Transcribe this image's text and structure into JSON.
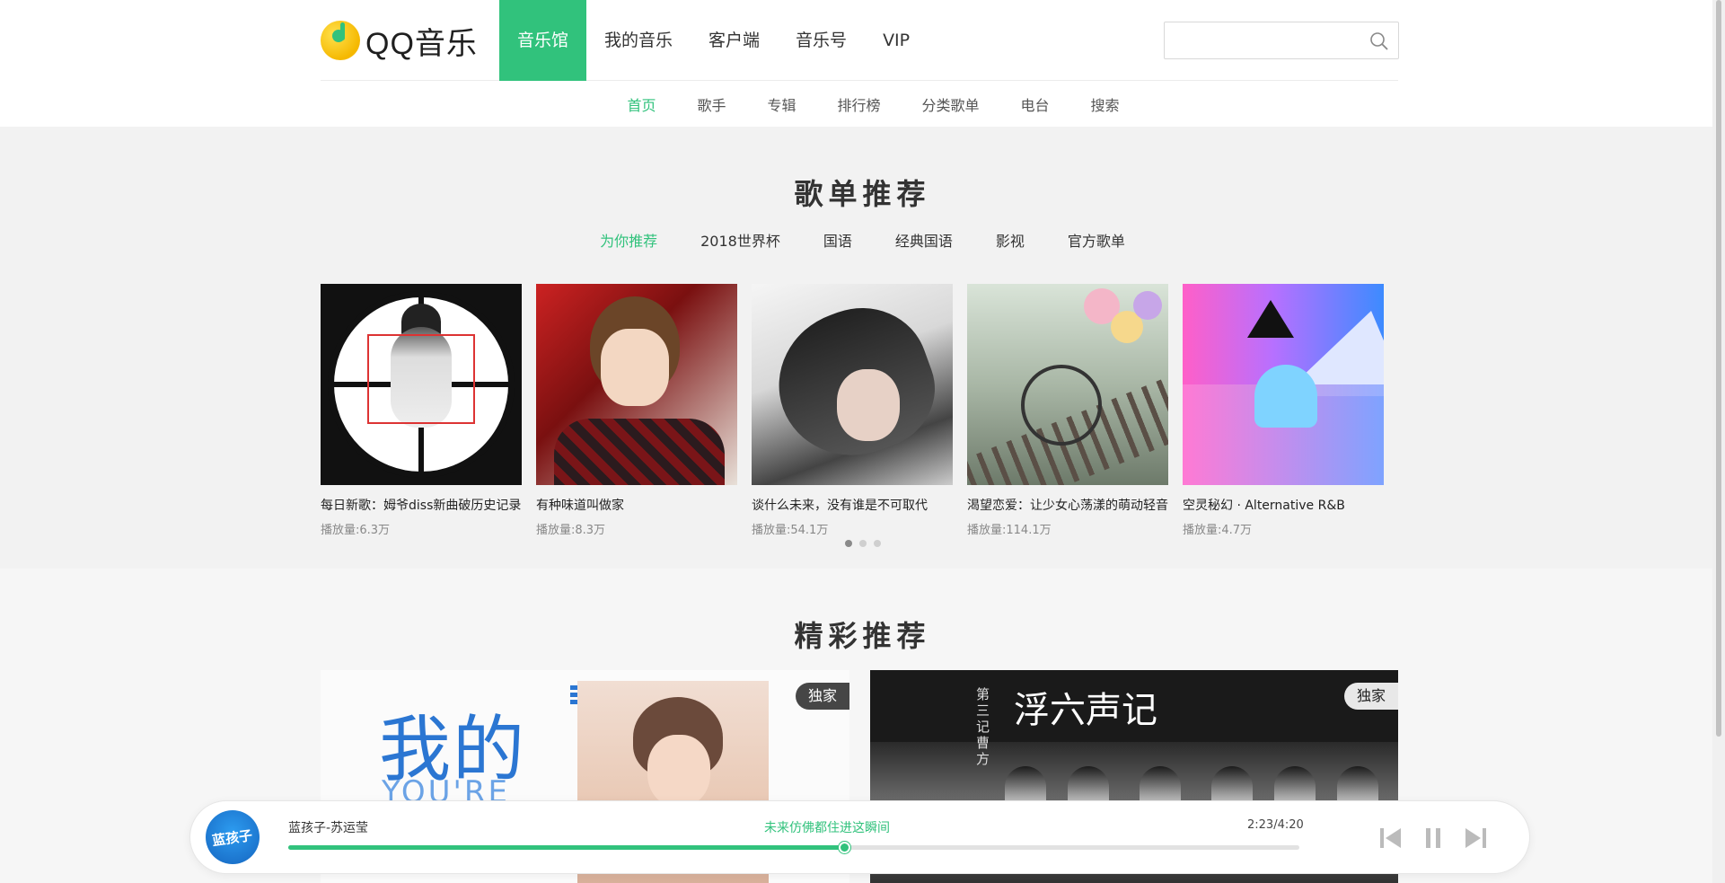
{
  "header": {
    "logo_text": "QQ音乐",
    "nav": [
      {
        "label": "音乐馆",
        "active": true
      },
      {
        "label": "我的音乐",
        "active": false
      },
      {
        "label": "客户端",
        "active": false
      },
      {
        "label": "音乐号",
        "active": false
      },
      {
        "label": "VIP",
        "active": false
      }
    ],
    "search": {
      "value": "",
      "placeholder": "",
      "icon": "search-icon"
    }
  },
  "subnav": [
    {
      "label": "首页",
      "active": true
    },
    {
      "label": "歌手",
      "active": false
    },
    {
      "label": "专辑",
      "active": false
    },
    {
      "label": "排行榜",
      "active": false
    },
    {
      "label": "分类歌单",
      "active": false
    },
    {
      "label": "电台",
      "active": false
    },
    {
      "label": "搜索",
      "active": false
    }
  ],
  "playlists": {
    "title": "歌单推荐",
    "tabs": [
      {
        "label": "为你推荐",
        "active": true
      },
      {
        "label": "2018世界杯",
        "active": false
      },
      {
        "label": "国语",
        "active": false
      },
      {
        "label": "经典国语",
        "active": false
      },
      {
        "label": "影视",
        "active": false
      },
      {
        "label": "官方歌单",
        "active": false
      }
    ],
    "items": [
      {
        "title": "每日新歌：姆爷diss新曲破历史记录",
        "plays": "播放量:6.3万"
      },
      {
        "title": "有种味道叫做家",
        "plays": "播放量:8.3万"
      },
      {
        "title": "谈什么未来，没有谁是不可取代",
        "plays": "播放量:54.1万"
      },
      {
        "title": "渴望恋爱：让少女心荡漾的萌动轻音",
        "plays": "播放量:114.1万"
      },
      {
        "title": "空灵秘幻 · Alternative R&B",
        "plays": "播放量:4.7万"
      }
    ],
    "pagination": {
      "pages": 3,
      "current": 1
    }
  },
  "featured": {
    "title": "精彩推荐",
    "banners": [
      {
        "badge": "独家",
        "art_text": "我的",
        "art_sub": "YOU'RE"
      },
      {
        "badge": "独家",
        "art_text": "浮六声记",
        "art_side": "第三记 曹方"
      }
    ]
  },
  "player": {
    "cover_text": "蓝孩子",
    "song": "蓝孩子-苏运莹",
    "lyric": "未来仿佛都住进这瞬间",
    "time": "2:23/4:20",
    "progress": 0.55,
    "accent": "#31c27c",
    "controls": [
      "prev-icon",
      "pause-icon",
      "next-icon"
    ]
  },
  "colors": {
    "brand_green": "#31c27c",
    "section_bg": "#f2f2f2"
  }
}
